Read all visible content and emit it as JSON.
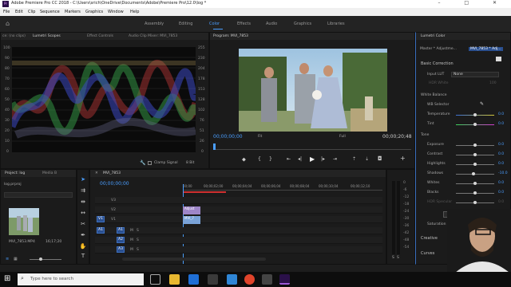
{
  "app": {
    "title": "Adobe Premiere Pro CC 2018 - C:\\Users\\srich\\OneDrive\\Documents\\Adobe\\Premiere Pro\\12.0\\log *",
    "icon_text": "Pr"
  },
  "window_controls": [
    "–",
    "□",
    "✕"
  ],
  "menu": [
    "File",
    "Edit",
    "Clip",
    "Sequence",
    "Markers",
    "Graphics",
    "Window",
    "Help"
  ],
  "workspaces": [
    "Assembly",
    "Editing",
    "Color",
    "Effects",
    "Audio",
    "Graphics",
    "Libraries"
  ],
  "active_workspace": "Color",
  "scopes_panel": {
    "tabs": [
      "ce: (no clips)",
      "Lumetri Scopes",
      "Effect Controls",
      "Audio Clip Mixer: MVI_7853"
    ],
    "left_scale": [
      "100",
      "90",
      "80",
      "70",
      "60",
      "50",
      "40",
      "30",
      "20",
      "10",
      "0"
    ],
    "right_scale": [
      "255",
      "230",
      "204",
      "178",
      "153",
      "128",
      "102",
      "76",
      "51",
      "26",
      "0"
    ],
    "clamp_label": "Clamp Signal",
    "bit_depth": "8 Bit"
  },
  "program_monitor": {
    "tab": "Program: MVI_7853",
    "timecode": "00;00;00;00",
    "fit": "Fit",
    "quality": "Full",
    "duration": "00;00;20;48"
  },
  "lumetri": {
    "tab": "Lumetri Color",
    "master": "Master * Adjustme...",
    "clip": "MVI_7853 * Adj...",
    "basic_correction": "Basic Correction",
    "input_lut_label": "Input LUT",
    "input_lut_value": "None",
    "hdr_white_label": "HDR White",
    "hdr_white_value": "100",
    "white_balance": "White Balance",
    "wb_selector": "WB Selector",
    "controls": [
      {
        "label": "Temperature",
        "value": "0.0",
        "pos": 0.5
      },
      {
        "label": "Tint",
        "value": "0.0",
        "pos": 0.5
      }
    ],
    "tone": "Tone",
    "tone_controls": [
      {
        "label": "Exposure",
        "value": "0.0",
        "pos": 0.5
      },
      {
        "label": "Contrast",
        "value": "0.0",
        "pos": 0.5
      },
      {
        "label": "Highlights",
        "value": "0.0",
        "pos": 0.5
      },
      {
        "label": "Shadows",
        "value": "-10.0",
        "pos": 0.45
      },
      {
        "label": "Whites",
        "value": "0.0",
        "pos": 0.5
      },
      {
        "label": "Blacks",
        "value": "0.0",
        "pos": 0.5
      },
      {
        "label": "HDR Specular",
        "value": "0.0",
        "pos": 0.5
      }
    ],
    "reset": "Reset",
    "saturation": "Saturation",
    "creative": "Creative",
    "curves": "Curves"
  },
  "project_panel": {
    "tabs": [
      "Project: log",
      "Media B"
    ],
    "file": "log.prproj",
    "clip_name": "MVI_7853.MP4",
    "clip_duration": "16;17;20"
  },
  "timeline": {
    "tab": "MVI_7853",
    "timecode": "00;00;00;00",
    "ruler": [
      "00;00",
      "00;00;02;00",
      "00;00;04;04",
      "00;00;06;04",
      "00;00;08;04",
      "00;00;10;04",
      "00;00;12;10"
    ],
    "video_tracks": [
      "V3",
      "V2",
      "V1"
    ],
    "audio_tracks": [
      "A1",
      "A2",
      "A3"
    ],
    "clip_fx": "Adjust",
    "clip_name": "MVI_7"
  },
  "audio_meter": {
    "scale": [
      "0",
      "-6",
      "-12",
      "-18",
      "-24",
      "-30",
      "-36",
      "-42",
      "-48",
      "-54"
    ],
    "solo": "S",
    "solo2": "S"
  },
  "taskbar": {
    "search_placeholder": "Type here to search"
  }
}
